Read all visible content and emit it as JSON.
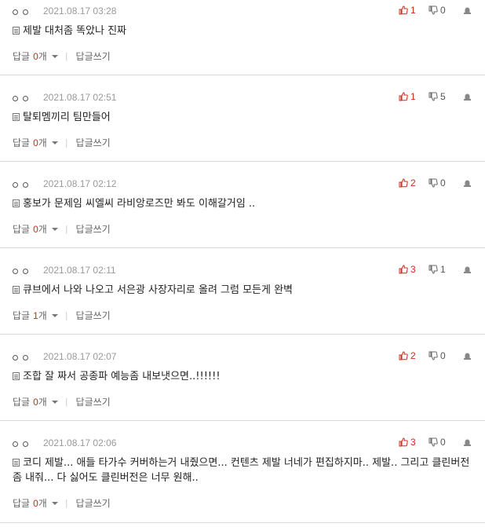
{
  "labels": {
    "reply": "답글",
    "reply_unit": "개",
    "write_reply": "답글쓰기",
    "separator": "|"
  },
  "colors": {
    "accent": "#d0281c",
    "muted": "#999999"
  },
  "comments": [
    {
      "date": "2021.08.17 03:28",
      "text": "제발 대처좀 똑았나 진짜",
      "likes": "1",
      "dislikes": "0",
      "replies": "0"
    },
    {
      "date": "2021.08.17 02:51",
      "text": "탈퇴멤끼리 팀만들어",
      "likes": "1",
      "dislikes": "5",
      "replies": "0"
    },
    {
      "date": "2021.08.17 02:12",
      "text": "홍보가 문제임 씨엘씨 라비앙로즈만 봐도 이해갈거임 ..",
      "likes": "2",
      "dislikes": "0",
      "replies": "0"
    },
    {
      "date": "2021.08.17 02:11",
      "text": "큐브에서 나와 나오고 서은광 사장자리로 올려 그럼 모든게 완벽",
      "likes": "3",
      "dislikes": "1",
      "replies": "1"
    },
    {
      "date": "2021.08.17 02:07",
      "text": "조합 잘 짜서 공종파 예능좀 내보냇으면..!!!!!!",
      "likes": "2",
      "dislikes": "0",
      "replies": "0"
    },
    {
      "date": "2021.08.17 02:06",
      "text": "코디 제발... 애들 타가수 커버하는거 내줬으면... 컨텐츠 제발 너네가 편집하지마.. 제발.. 그리고 클린버전 좀 내줘... 다 싫어도 클린버전은 너무 원해..",
      "likes": "3",
      "dislikes": "0",
      "replies": "0"
    }
  ]
}
